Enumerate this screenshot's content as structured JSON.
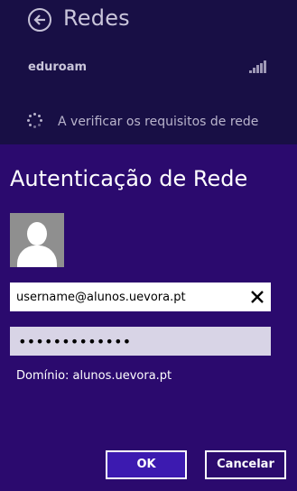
{
  "networks_panel": {
    "title": "Redes",
    "network_name": "eduroam",
    "status": "A verificar os requisitos de rede"
  },
  "auth": {
    "title": "Autenticação de Rede",
    "username": "username@alunos.uevora.pt",
    "password_mask": "•••••••••••••",
    "domain": "Domínio: alunos.uevora.pt"
  },
  "buttons": {
    "ok": "OK",
    "cancel": "Cancelar"
  },
  "icons": {
    "back": "back-arrow-icon",
    "signal": "wifi-signal-icon",
    "spinner": "loading-spinner-icon",
    "avatar": "user-avatar-icon",
    "clear": "close-icon"
  },
  "colors": {
    "background": "#2b0a6e",
    "panel": "#180f45",
    "ok_button": "#3c1ab0",
    "password_field": "#d8d4e6"
  }
}
